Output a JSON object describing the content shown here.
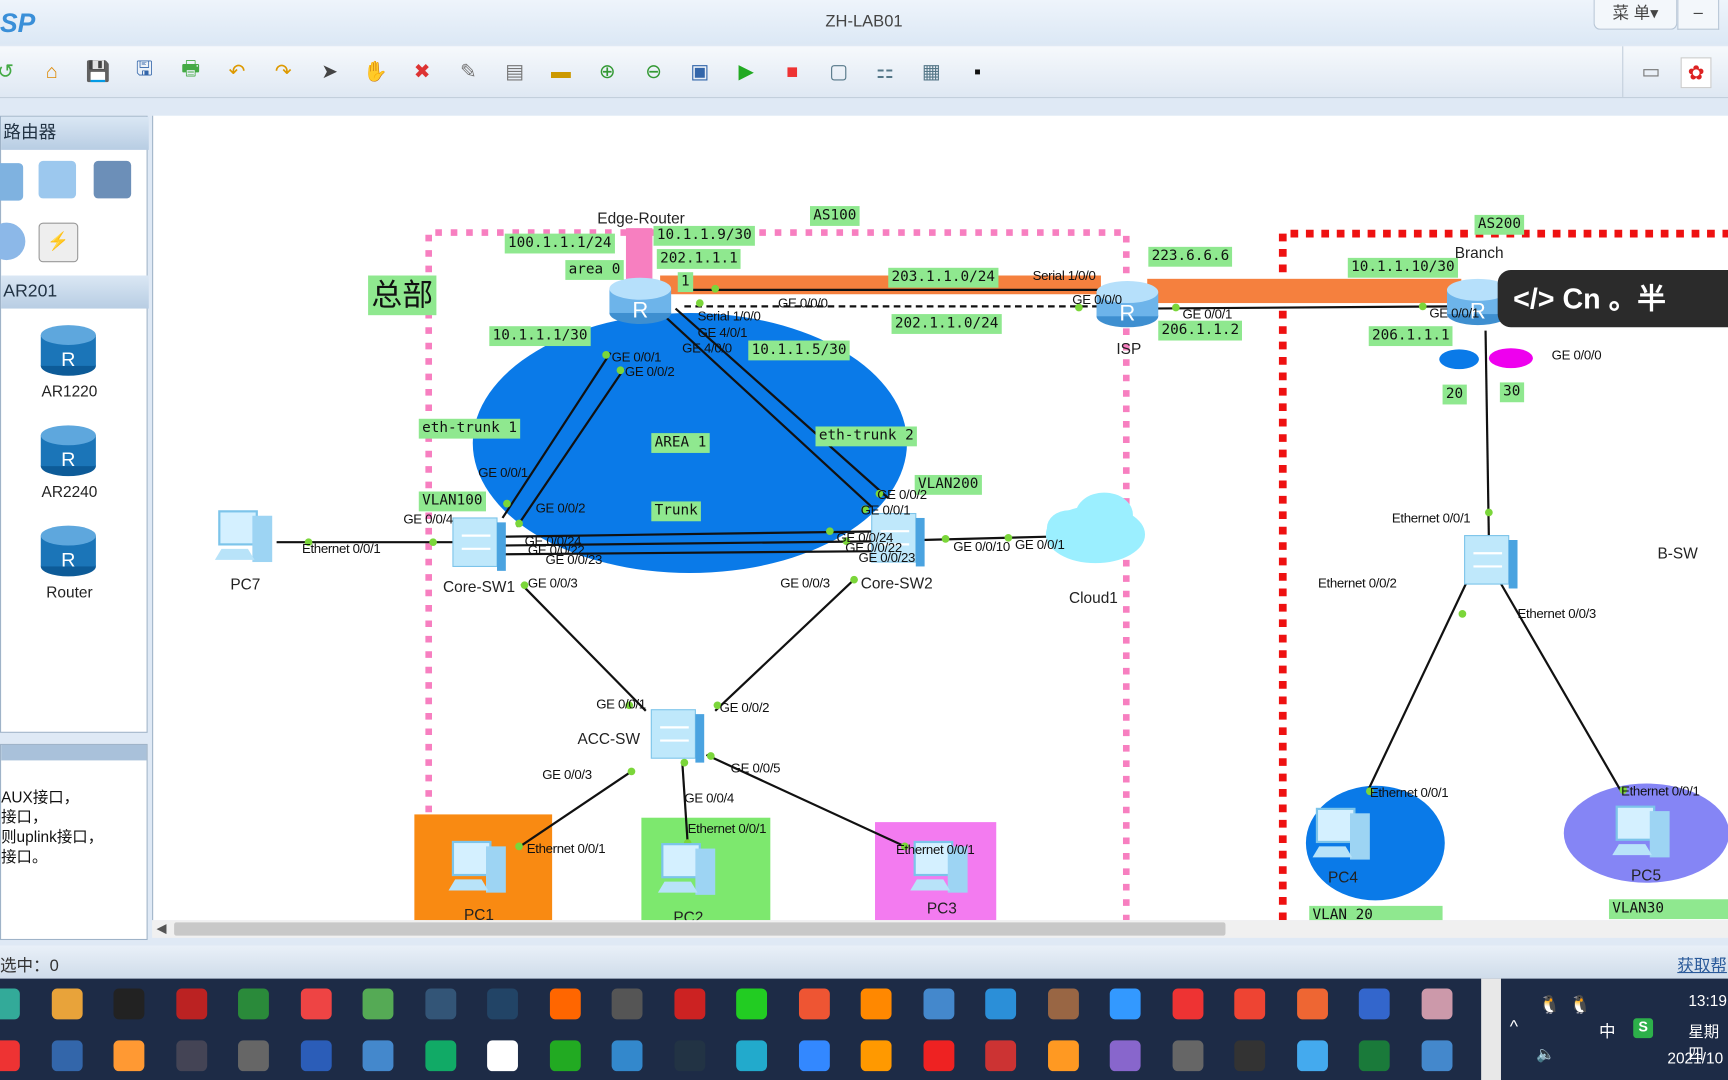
{
  "app": {
    "logo": "SP",
    "title": "ZH-LAB01",
    "menu_label": "菜 单▾",
    "minimize_label": "–"
  },
  "toolbar": {
    "icons": [
      "new-topology-icon",
      "open-icon",
      "save-icon",
      "save-as-icon",
      "print-icon",
      "undo-icon",
      "redo-icon",
      "select-icon",
      "pan-hand-icon",
      "delete-icon",
      "delete-link-icon",
      "text-note-icon",
      "rectangle-icon",
      "zoom-in-icon",
      "zoom-out-icon",
      "fit-icon",
      "start-device-icon",
      "stop-device-icon",
      "capture-icon",
      "topology-icon",
      "grid-icon",
      "console-icon"
    ],
    "right_icons": [
      "feedback-icon",
      "huawei-logo-icon"
    ]
  },
  "sidebar": {
    "category_title": "路由器",
    "category_icons": [
      "router-type-icon",
      "wireless-icon",
      "firewall-icon",
      "cloud-icon",
      "power-icon"
    ],
    "selected_model": "AR201",
    "models": [
      "AR1220",
      "AR2240",
      "Router"
    ],
    "description_lines": [
      "AUX接口，",
      "接口，",
      "则uplink接口，",
      "接口。"
    ]
  },
  "topology": {
    "title_big": "总部",
    "green_labels": [
      "AS100",
      "100.1.1.1/24",
      "10.1.1.9/30",
      "202.1.1.1",
      "area 0",
      "1",
      "203.1.1.0/24",
      "202.1.1.0/24",
      "223.6.6.6",
      "206.1.1.2",
      "10.1.1.10/30",
      "AS200",
      "206.1.1.1",
      "20",
      "30",
      "10.1.1.1/30",
      "10.1.1.5/30",
      "eth-trunk 1",
      "AREA 1",
      "eth-trunk 2",
      "VLAN100",
      "VLAN200",
      "Trunk",
      "VLAN 20",
      "VLAN30"
    ],
    "devices": [
      {
        "name": "Edge-Router",
        "type": "router"
      },
      {
        "name": "ISP",
        "type": "router"
      },
      {
        "name": "Branch",
        "type": "router"
      },
      {
        "name": "Core-SW1",
        "type": "switch"
      },
      {
        "name": "Core-SW2",
        "type": "switch"
      },
      {
        "name": "ACC-SW",
        "type": "switch"
      },
      {
        "name": "B-SW",
        "type": "switch"
      },
      {
        "name": "PC7",
        "type": "pc"
      },
      {
        "name": "PC1",
        "type": "pc"
      },
      {
        "name": "PC2",
        "type": "pc"
      },
      {
        "name": "PC3",
        "type": "pc"
      },
      {
        "name": "PC4",
        "type": "pc"
      },
      {
        "name": "PC5",
        "type": "pc"
      },
      {
        "name": "Cloud1",
        "type": "cloud"
      }
    ],
    "port_labels": [
      "Serial 1/0/0",
      "GE 4/0/1",
      "GE 4/0/0",
      "GE 0/0/0",
      "Serial 1/0/0",
      "GE 0/0/0",
      "GE 0/0/1",
      "GE 0/0/1",
      "GE 0/0/0",
      "GE 0/0/1",
      "GE 0/0/2",
      "GE 0/0/1",
      "GE 0/0/2",
      "GE 0/0/4",
      "Ethernet 0/0/1",
      "GE 0/0/24",
      "GE 0/0/22",
      "GE 0/0/23",
      "GE 0/0/2",
      "GE 0/0/1",
      "GE 0/0/24",
      "GE 0/0/22",
      "GE 0/0/23",
      "GE 0/0/10",
      "GE 0/0/1",
      "GE 0/0/3",
      "GE 0/0/3",
      "GE 0/0/1",
      "GE 0/0/2",
      "GE 0/0/3",
      "GE 0/0/4",
      "GE 0/0/5",
      "Ethernet 0/0/1",
      "Ethernet 0/0/1",
      "Ethernet 0/0/1",
      "Ethernet 0/0/1",
      "Ethernet 0/0/2",
      "Ethernet 0/0/3",
      "Ethernet 0/0/1",
      "Ethernet 0/0/1"
    ],
    "colors": {
      "as100_border": "#f77fc0",
      "as200_border": "#ee1111",
      "area1": "#0a7ae8",
      "serial_link": "#f5803e",
      "label_bg": "#8fe88f"
    }
  },
  "overlay": {
    "text": "</> Cn 。半"
  },
  "status": {
    "selected": "选中：0",
    "help_link": "获取帮"
  },
  "taskbar": {
    "row1": [
      "browser",
      "folder",
      "qq",
      "pdf",
      "camtasia",
      "chrome",
      "notepad",
      "remote-desktop",
      "powershell",
      "firefox",
      "calculator",
      "filezilla",
      "wechat",
      "mail",
      "search",
      "ensp",
      "shark",
      "books",
      "baidu-netdisk",
      "wps",
      "c-app",
      "snail",
      "save",
      "paint"
    ],
    "row2": [
      "wps-app",
      "visio",
      "xmind-grid",
      "keepass",
      "vm",
      "word",
      "monitor",
      "xmind",
      "editor",
      "pycharm",
      "doc-viewer",
      "vscode",
      "cloud",
      "feishu",
      "sublime",
      "netease-music",
      "pokeball",
      "fish",
      "purple-app",
      "doc",
      "tcpip",
      "feather",
      "excel",
      "card"
    ],
    "tray": {
      "time": "13:19",
      "weekday": "星期四",
      "date": "2021/10",
      "ime": "中"
    }
  }
}
